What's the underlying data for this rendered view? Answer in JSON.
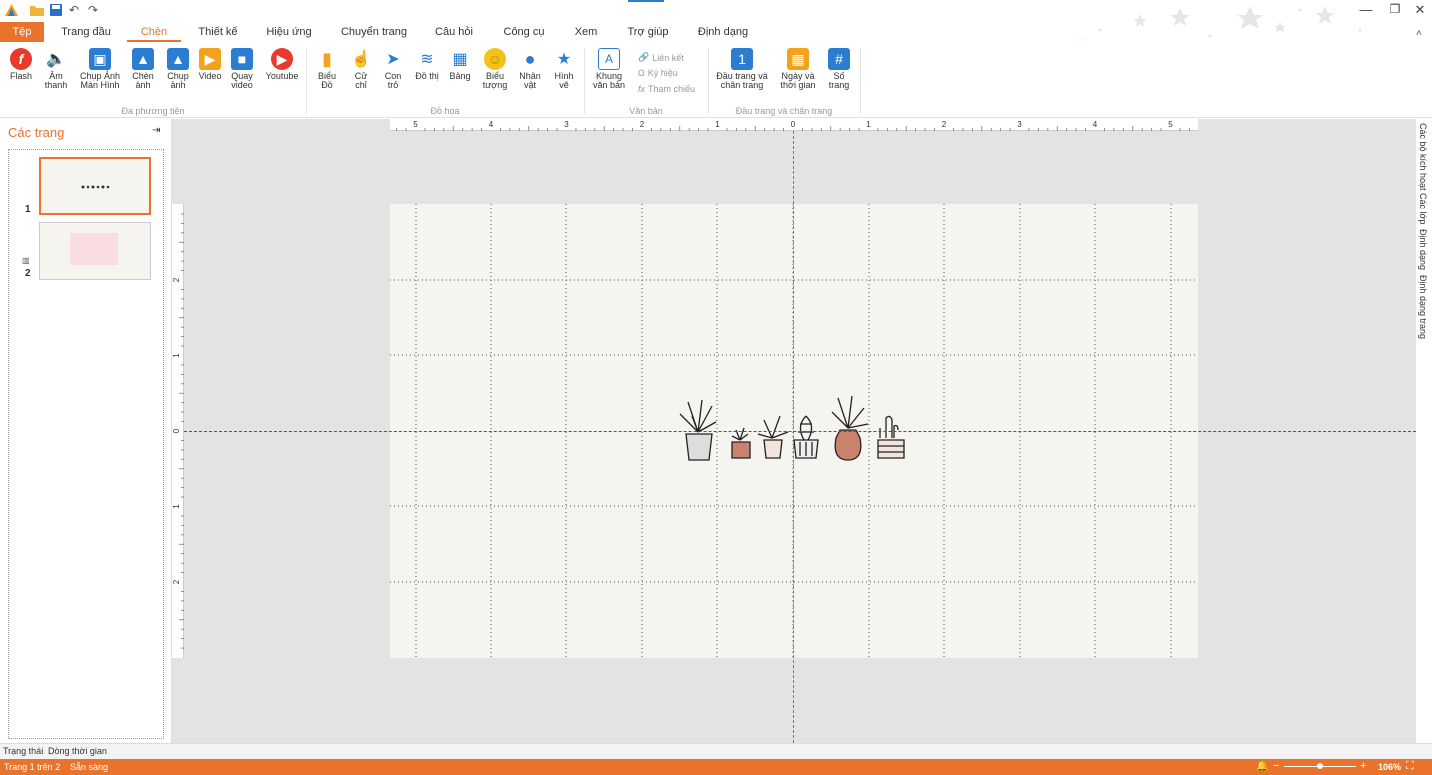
{
  "title_bar": {
    "icons": [
      "app-logo-icon",
      "open-folder-icon",
      "save-icon",
      "undo-icon",
      "redo-icon"
    ]
  },
  "tabs": [
    {
      "label": "Tệp",
      "key": "file"
    },
    {
      "label": "Trang đầu",
      "key": "home"
    },
    {
      "label": "Chèn",
      "key": "insert",
      "active": true
    },
    {
      "label": "Thiết kế",
      "key": "design"
    },
    {
      "label": "Hiệu ứng",
      "key": "effects"
    },
    {
      "label": "Chuyển trang",
      "key": "transitions"
    },
    {
      "label": "Câu hỏi",
      "key": "questions"
    },
    {
      "label": "Công cụ",
      "key": "tools"
    },
    {
      "label": "Xem",
      "key": "view"
    },
    {
      "label": "Trợ giúp",
      "key": "help"
    },
    {
      "label": "Định dạng",
      "key": "format"
    }
  ],
  "ribbon": {
    "media": {
      "flash": "Flash",
      "audio": "Âm thanh",
      "screenshot": "Chụp Ảnh Màn Hình",
      "insert_image": "Chèn ảnh",
      "capture_image": "Chụp ảnh",
      "video": "Video",
      "record_video": "Quay video",
      "youtube": "Youtube",
      "group_label": "Đa phương tiện"
    },
    "graphics": {
      "chart": "Biểu Đồ",
      "gesture": "Cử chỉ",
      "pointer": "Con trỏ",
      "graph": "Đồ thị",
      "table": "Bảng",
      "emoji": "Biểu tượng",
      "character": "Nhân vật",
      "shape": "Hình vẽ",
      "group_label": "Đồ họa"
    },
    "text": {
      "textbox": "Khung văn bản",
      "link": "Liên kết",
      "symbol": "Ký hiệu",
      "reference": "Tham chiếu",
      "group_label": "Văn bản"
    },
    "header_footer": {
      "header_footer": "Đầu trang và chân trang",
      "datetime": "Ngày và thời gian",
      "page_number": "Số trang",
      "group_label": "Đầu trang và chân trang"
    }
  },
  "pages_panel": {
    "title": "Các trang",
    "pages": [
      {
        "number": "1"
      },
      {
        "number": "2"
      }
    ]
  },
  "ruler": {
    "h_labels": [
      "5",
      "4",
      "3",
      "2",
      "1",
      "0",
      "1",
      "2",
      "3",
      "4",
      "5"
    ],
    "v_labels": [
      "2",
      "1",
      "0",
      "1",
      "2"
    ]
  },
  "right_panel": [
    "Các bộ kích hoạt",
    "Các lớp",
    "Định dạng",
    "Định dạng trang"
  ],
  "status": {
    "tabs": [
      "Trạng thái",
      "Dòng thời gian"
    ],
    "page_info": "Trang 1 trên 2",
    "ready": "Sẵn sàng",
    "zoom": "106%",
    "zoom_level": 0.5
  },
  "colors": {
    "accent": "#e9732b",
    "slide_bg": "#f5f4ef",
    "canvas_bg": "#e3e3e3"
  }
}
